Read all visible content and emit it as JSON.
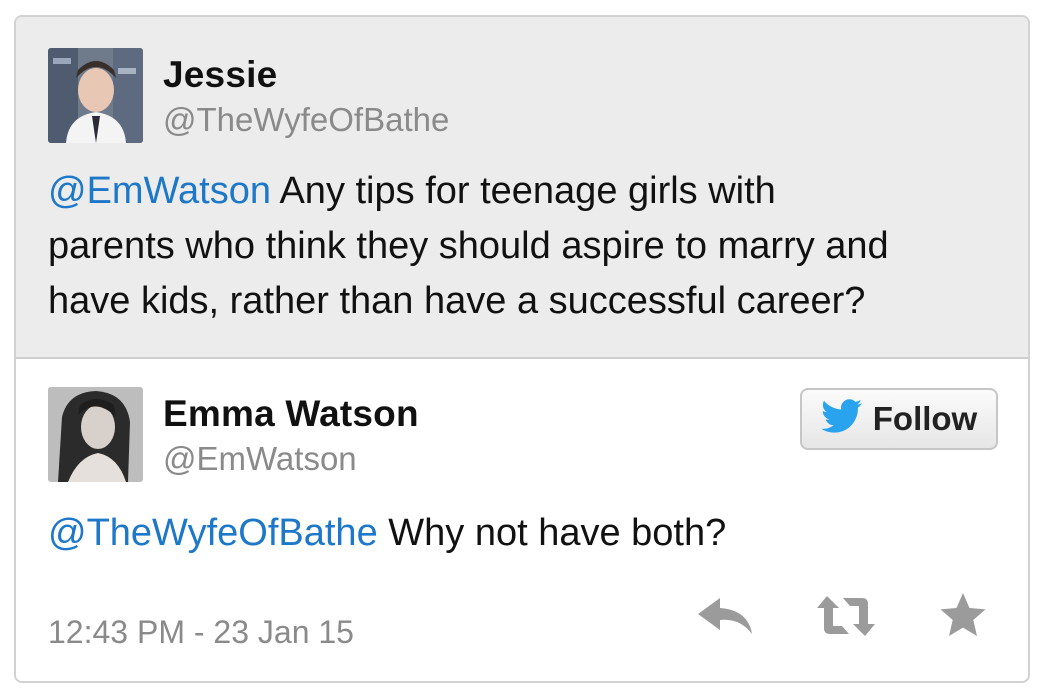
{
  "parent_tweet": {
    "name": "Jessie",
    "handle": "@TheWyfeOfBathe",
    "mention": "@EmWatson",
    "body_line1": " Any tips for teenage girls with",
    "body_line2": "parents who think they should aspire to marry and",
    "body_line3": "have kids, rather than have a successful career?"
  },
  "reply_tweet": {
    "name": "Emma Watson",
    "handle": "@EmWatson",
    "mention": "@TheWyfeOfBathe",
    "body": " Why not have both?",
    "timestamp": "12:43 PM - 23 Jan 15"
  },
  "follow_button": {
    "label": "Follow",
    "icon": "twitter-bird-icon"
  },
  "actions": [
    {
      "name": "reply",
      "icon": "reply-icon"
    },
    {
      "name": "retweet",
      "icon": "retweet-icon"
    },
    {
      "name": "favorite",
      "icon": "star-icon"
    }
  ],
  "colors": {
    "link": "#1d78c9",
    "twitter_blue": "#2aa3ef",
    "muted": "#8a8a8a",
    "parent_bg": "#ececec",
    "icon_gray": "#9b9b9b"
  }
}
